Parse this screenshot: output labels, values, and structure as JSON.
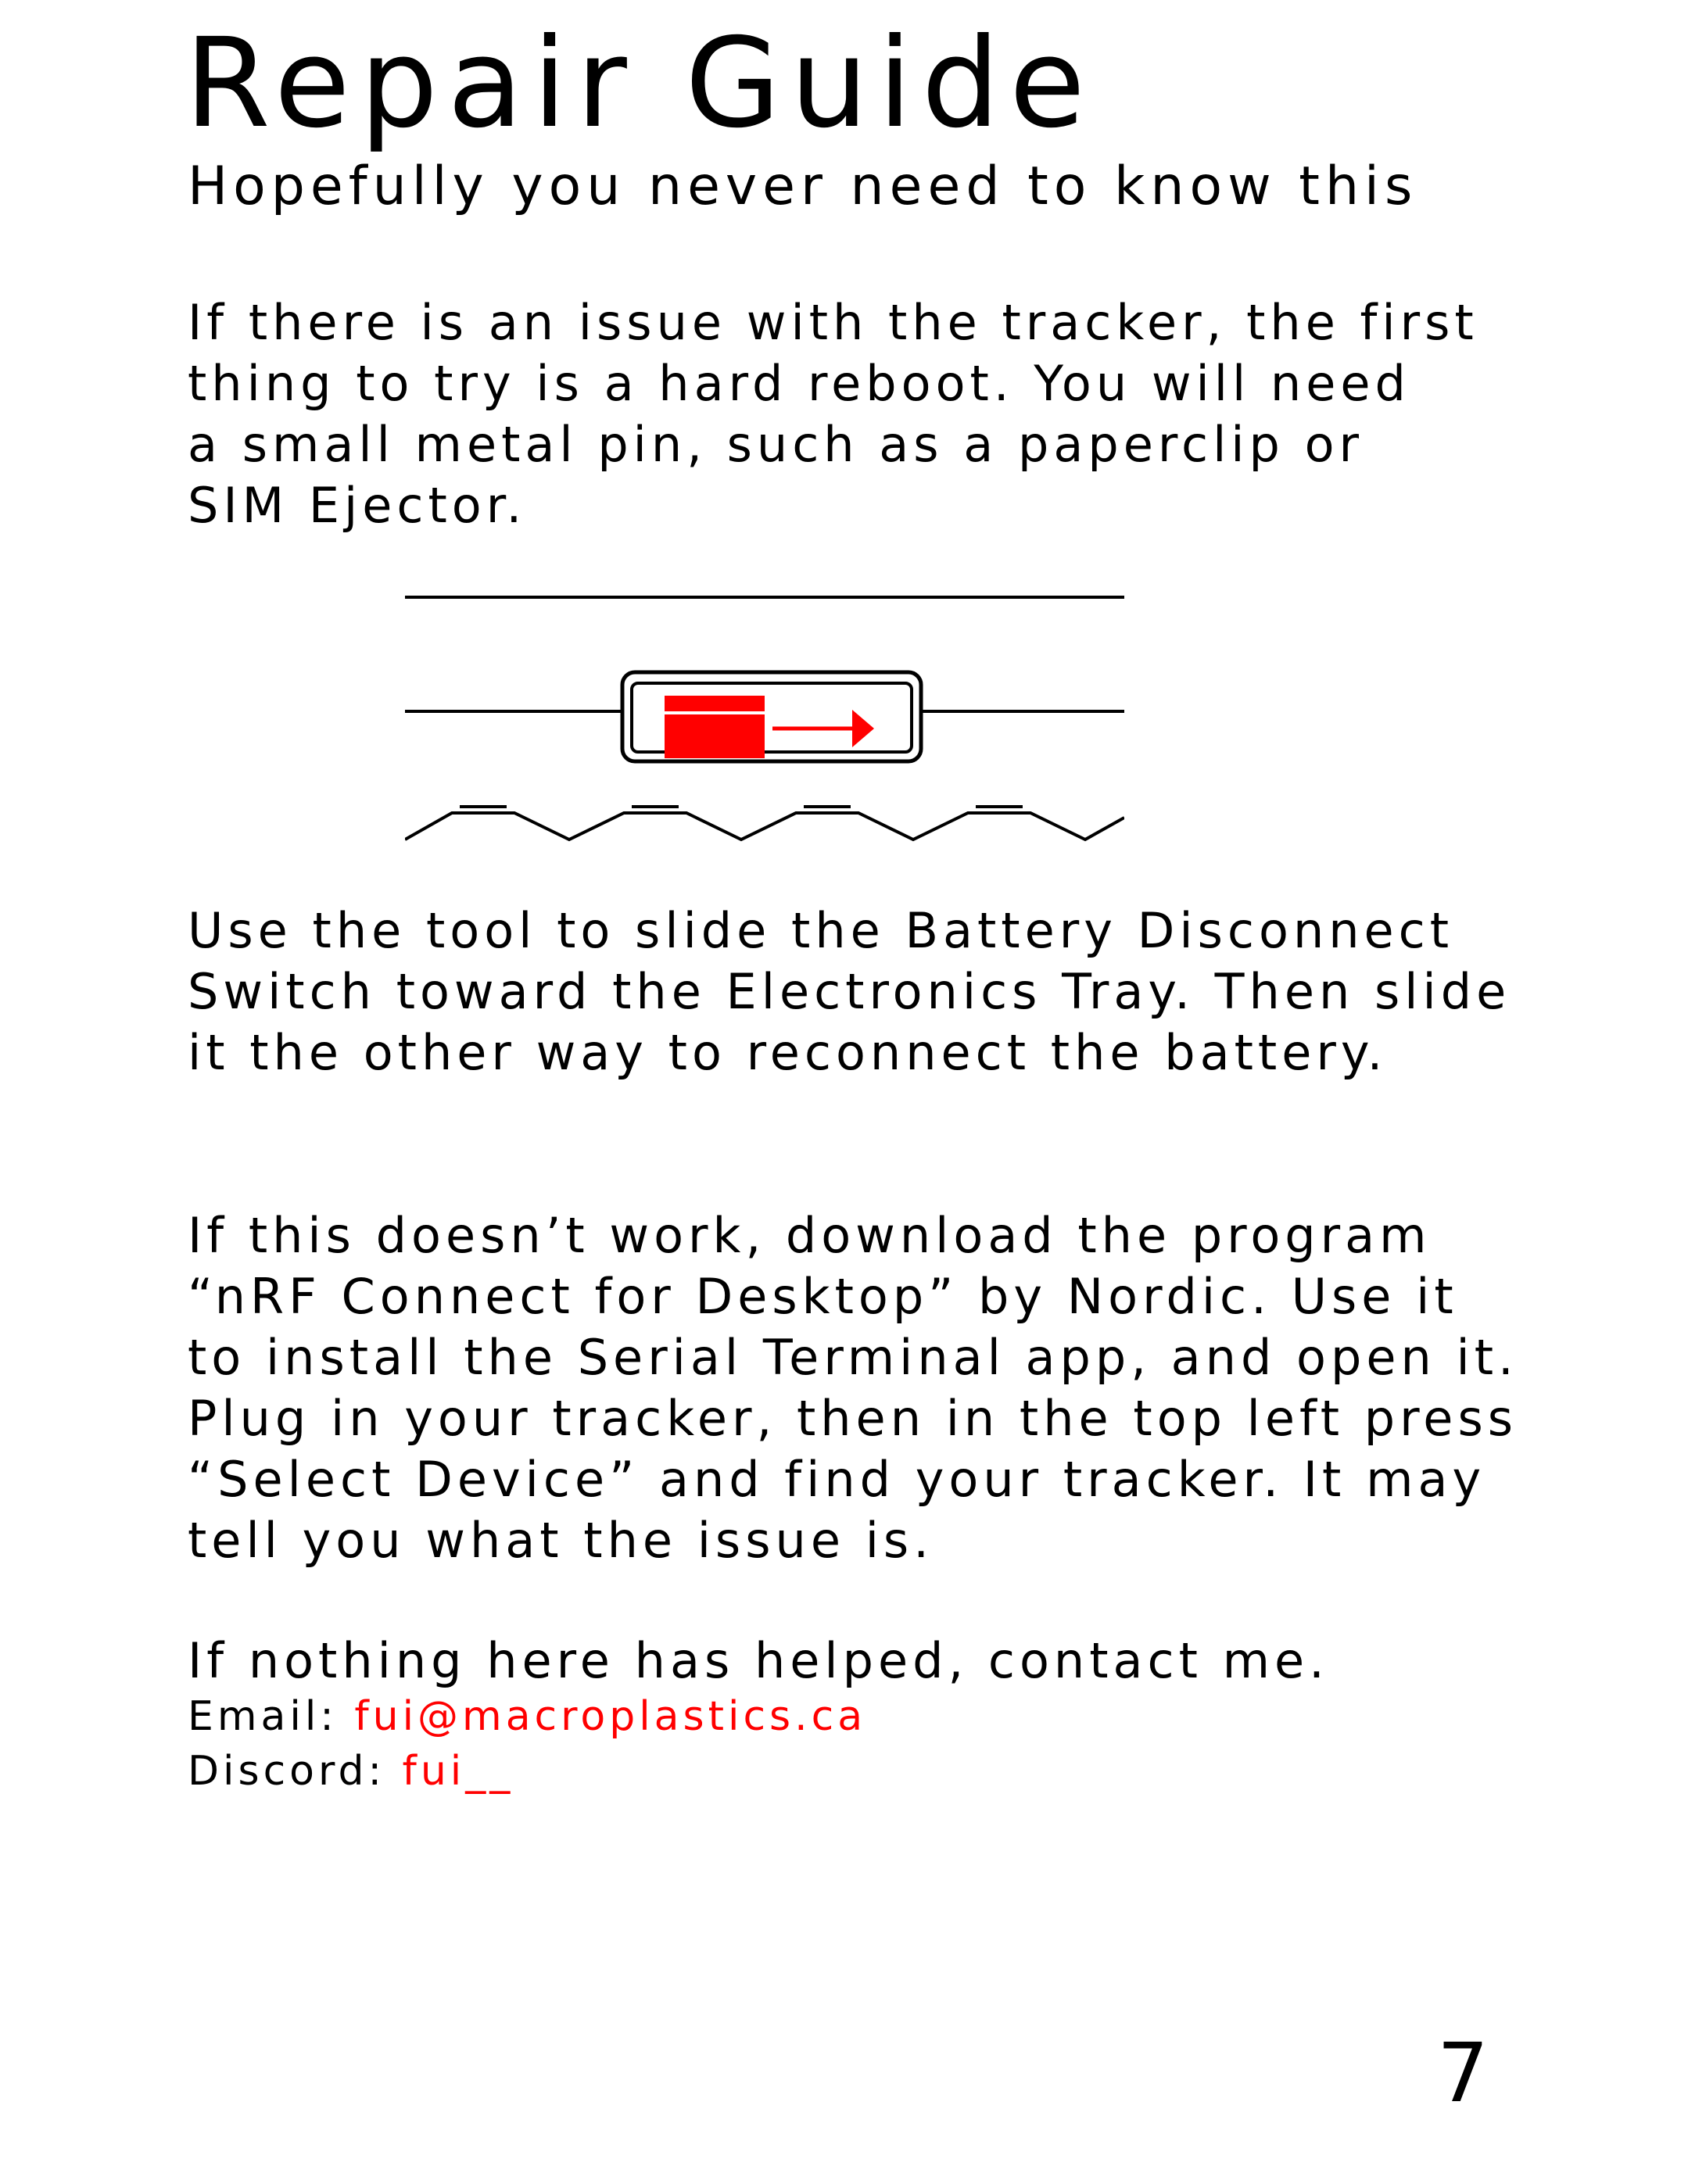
{
  "header": {
    "title": "Repair Guide",
    "subtitle": "Hopefully you never need to know this"
  },
  "intro": {
    "lines": [
      "If there is an issue with the tracker, the first",
      "thing to try is a hard reboot. You will need",
      "a small metal pin, such as a paperclip or",
      "SIM Ejector."
    ]
  },
  "diagram": {
    "switch_color": "#ff0000",
    "line_color": "#000000",
    "arrow_direction": "right"
  },
  "instructions": {
    "lines": [
      "Use the tool to slide the Battery Disconnect",
      "Switch toward the Electronics Tray. Then slide",
      "it the other way to reconnect the battery."
    ]
  },
  "advanced": {
    "lines": [
      "If this doesn’t work, download the program",
      "“nRF Connect for Desktop” by Nordic. Use it",
      "to install the Serial Terminal app, and open it.",
      "Plug in your tracker, then in the top left press",
      "“Select Device” and find your tracker. It may",
      "tell you what the issue is."
    ]
  },
  "contact": {
    "intro": "If nothing here has helped, contact me.",
    "email_label": "Email: ",
    "email_value": "fui@macroplastics.ca",
    "discord_label": "Discord: ",
    "discord_value": "fui__"
  },
  "footer": {
    "page_number": "7"
  }
}
